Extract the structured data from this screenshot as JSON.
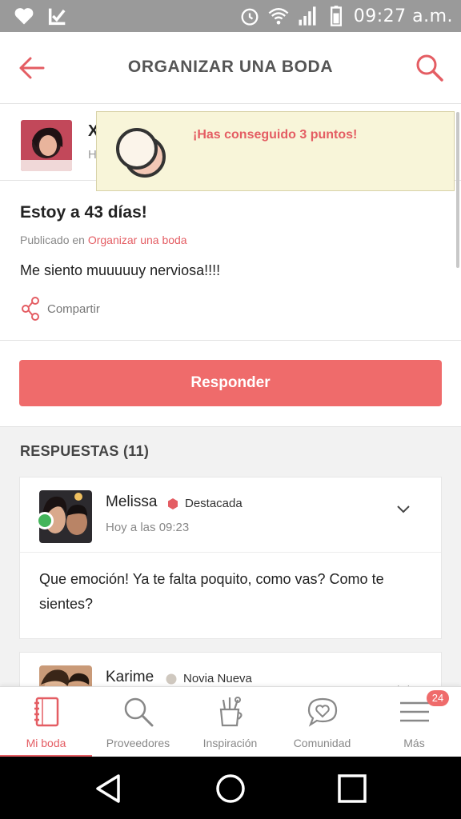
{
  "status_bar": {
    "time": "09:27 a.m.",
    "icons": [
      "heart-icon",
      "check-icon",
      "alarm-icon",
      "wifi-icon",
      "signal-icon",
      "battery-icon"
    ]
  },
  "app_bar": {
    "title": "ORGANIZAR UNA BODA",
    "icons": [
      "back-arrow-icon",
      "search-icon"
    ]
  },
  "author": {
    "name_initial": "X",
    "sub_initial": "H"
  },
  "toast": {
    "message": "¡Has conseguido 3 puntos!",
    "icon": "coins-icon"
  },
  "post": {
    "title": "Estoy a 43 días!",
    "meta_prefix": "Publicado en ",
    "meta_link": "Organizar una boda",
    "body": "Me siento muuuuuy nerviosa!!!!",
    "share_label": "Compartir"
  },
  "reply_button": "Responder",
  "responses": {
    "title": "RESPUESTAS (11)",
    "items": [
      {
        "name": "Melissa",
        "badge": "Destacada",
        "time": "Hoy a las 09:23",
        "text": "Que emoción! Ya te falta poquito, como vas? Como te sientes?"
      },
      {
        "name": "Karime",
        "badge": "Novia Nueva"
      }
    ]
  },
  "bottom_nav": {
    "items": [
      {
        "label": "Mi boda",
        "icon": "notebook-icon"
      },
      {
        "label": "Proveedores",
        "icon": "search-icon"
      },
      {
        "label": "Inspiración",
        "icon": "tools-cup-icon"
      },
      {
        "label": "Comunidad",
        "icon": "chat-heart-icon"
      },
      {
        "label": "Más",
        "icon": "menu-icon",
        "badge": "24"
      }
    ]
  },
  "colors": {
    "accent": "#e45d63",
    "button": "#ef6b6b",
    "toast_bg": "#f8f5d9",
    "online": "#43b55a"
  }
}
